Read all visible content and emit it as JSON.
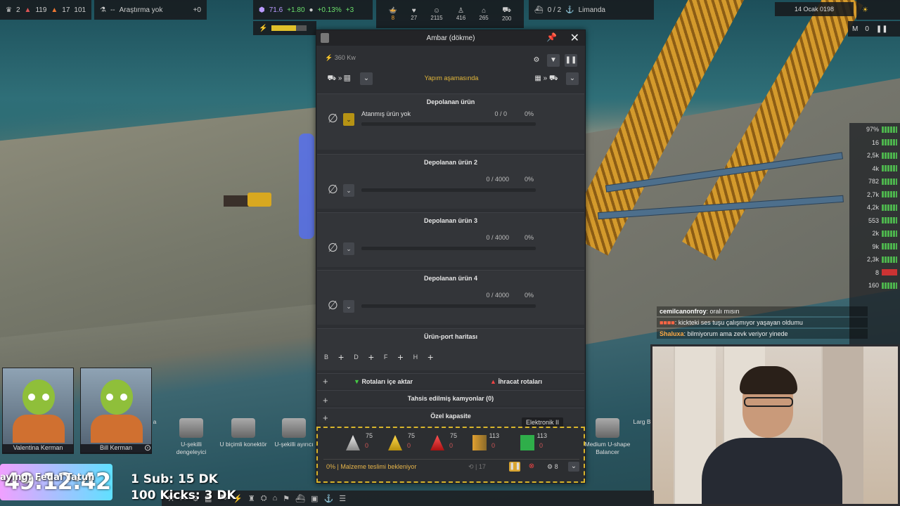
{
  "hud": {
    "ach_count": "2",
    "alert1_count": "119",
    "alert2_count": "17",
    "alert3_count": "101",
    "research_sep": "--",
    "research_label": "Araştırma yok",
    "research_value": "+0",
    "unity_value": "71.6",
    "unity_delta": "+1.80",
    "pop_pct": "+0.13%",
    "pop_delta": "+3",
    "food_count": "8",
    "health_count": "27",
    "pop_count": "2115",
    "workers_count": "416",
    "housing_count": "265",
    "vehicles_count": "200",
    "ships_label": "0 / 2",
    "port_label": "Limanda",
    "date_label": "14 Ocak 0198",
    "speed_labels": [
      "M",
      "0"
    ]
  },
  "panel": {
    "title": "Ambar (dökme)",
    "energy": "360 Kw",
    "status": "Yapım aşamasında",
    "slots": [
      {
        "title": "Depolanan ürün",
        "name": "Atanmış ürün yok",
        "qty": "0 / 0",
        "pct": "0%"
      },
      {
        "title": "Depolanan ürün 2",
        "name": "",
        "qty": "0 / 4000",
        "pct": "0%"
      },
      {
        "title": "Depolanan ürün 3",
        "name": "",
        "qty": "0 / 4000",
        "pct": "0%"
      },
      {
        "title": "Depolanan ürün 4",
        "name": "",
        "qty": "0 / 4000",
        "pct": "0%"
      }
    ],
    "map_title": "Ürün-port haritası",
    "map_ports": [
      "B",
      "D",
      "F",
      "H"
    ],
    "import_label": "Rotaları içe aktar",
    "export_label": "İhracat rotaları",
    "trucks_label": "Tahsis edilmiş kamyonlar (0)",
    "capacity_label": "Özel kapasite",
    "cargo": [
      {
        "n": "75",
        "z": "0"
      },
      {
        "n": "75",
        "z": "0"
      },
      {
        "n": "75",
        "z": "0"
      },
      {
        "n": "113",
        "z": "0"
      },
      {
        "n": "113",
        "z": "0"
      }
    ],
    "tooltip": "Elektronik II",
    "status_line": "0% | Malzeme teslimi bekleniyor",
    "workers_label": "17",
    "priority_label": "8"
  },
  "right_list": [
    "97%",
    "16",
    "2,5k",
    "4k",
    "782",
    "2,7k",
    "4,2k",
    "553",
    "2k",
    "9k",
    "2,3k",
    "8",
    "160"
  ],
  "chat": [
    {
      "user": "cemilcanonfroy",
      "msg": ": oralı mısın"
    },
    {
      "user": "",
      "msg": ": kickteki ses tuşu çalışmıyor yaşayan oldumu"
    },
    {
      "user": "Shaluxa",
      "msg": ": bilmiyorum ama zevk veriyor yinede"
    }
  ],
  "kerbals": [
    "Valentina Kerman",
    "Bill Kerman"
  ],
  "tools": [
    {
      "label": "a"
    },
    {
      "label": "U-şekilli dengeleyici"
    },
    {
      "label": "U biçimli konektör"
    },
    {
      "label": "U-şekilli ayırıcı"
    },
    {
      "label": "Medium U-shape Balancer"
    },
    {
      "label": "Larg B"
    }
  ],
  "overlay": {
    "timer": "49:12:42",
    "sub_line": "1 Sub: 15 DK",
    "kick_line": "100 Kicks: 3 DK",
    "ticker": "ayıng: Fedai Tatun"
  },
  "colors": {
    "accent": "#e4b83a",
    "panel_bg": "#2d2f33",
    "warning": "#d8b52c"
  }
}
